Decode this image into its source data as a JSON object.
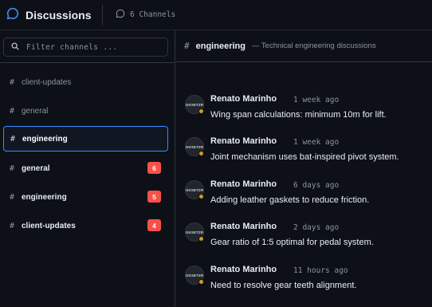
{
  "header": {
    "title": "Discussions",
    "channels_count": "6 Channels",
    "brand_icon": "chat-bubble-icon",
    "channels_icon": "chat-bubble-icon"
  },
  "sidebar": {
    "filter_placeholder": "Filter channels ...",
    "channels": [
      {
        "name": "client-updates",
        "unread": null,
        "state": "dim"
      },
      {
        "name": "general",
        "unread": null,
        "state": "dim"
      },
      {
        "name": "engineering",
        "unread": null,
        "state": "active"
      },
      {
        "name": "general",
        "unread": "6",
        "state": "unread"
      },
      {
        "name": "engineering",
        "unread": "5",
        "state": "unread"
      },
      {
        "name": "client-updates",
        "unread": "4",
        "state": "unread"
      }
    ]
  },
  "main": {
    "channel_name": "engineering",
    "channel_description": "— Technical engineering discussions",
    "messages": [
      {
        "author": "Renato Marinho",
        "time": "1 week ago",
        "text": "Wing span calculations: minimum 10m for lift."
      },
      {
        "author": "Renato Marinho",
        "time": "1 week ago",
        "text": "Joint mechanism uses bat-inspired pivot system."
      },
      {
        "author": "Renato Marinho",
        "time": "6 days ago",
        "text": "Adding leather gaskets to reduce friction."
      },
      {
        "author": "Renato Marinho",
        "time": "2 days ago",
        "text": "Gear ratio of 1:5 optimal for pedal system."
      },
      {
        "author": "Renato Marinho",
        "time": "11 hours ago",
        "text": "Need to resolve gear teeth alignment."
      }
    ]
  },
  "colors": {
    "accent": "#388bfd",
    "badge": "#f85149",
    "presence": "#d29922",
    "background": "#0d1117"
  }
}
